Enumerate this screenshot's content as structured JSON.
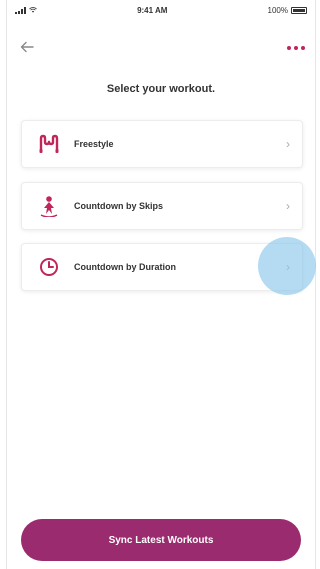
{
  "status_bar": {
    "time": "9:41 AM",
    "battery_text": "100%"
  },
  "nav": {
    "back_icon": "back-arrow-icon",
    "menu_icon": "more-dots-icon"
  },
  "page": {
    "title": "Select your workout."
  },
  "workouts": [
    {
      "label": "Freestyle",
      "icon": "freestyle-icon"
    },
    {
      "label": "Countdown by Skips",
      "icon": "jump-rope-person-icon"
    },
    {
      "label": "Countdown by Duration",
      "icon": "clock-icon"
    }
  ],
  "sync_button": {
    "label": "Sync Latest Workouts"
  },
  "colors": {
    "accent": "#9b2b6f",
    "icon_pink": "#c0265c",
    "tap_highlight": "#8cc8eb"
  }
}
